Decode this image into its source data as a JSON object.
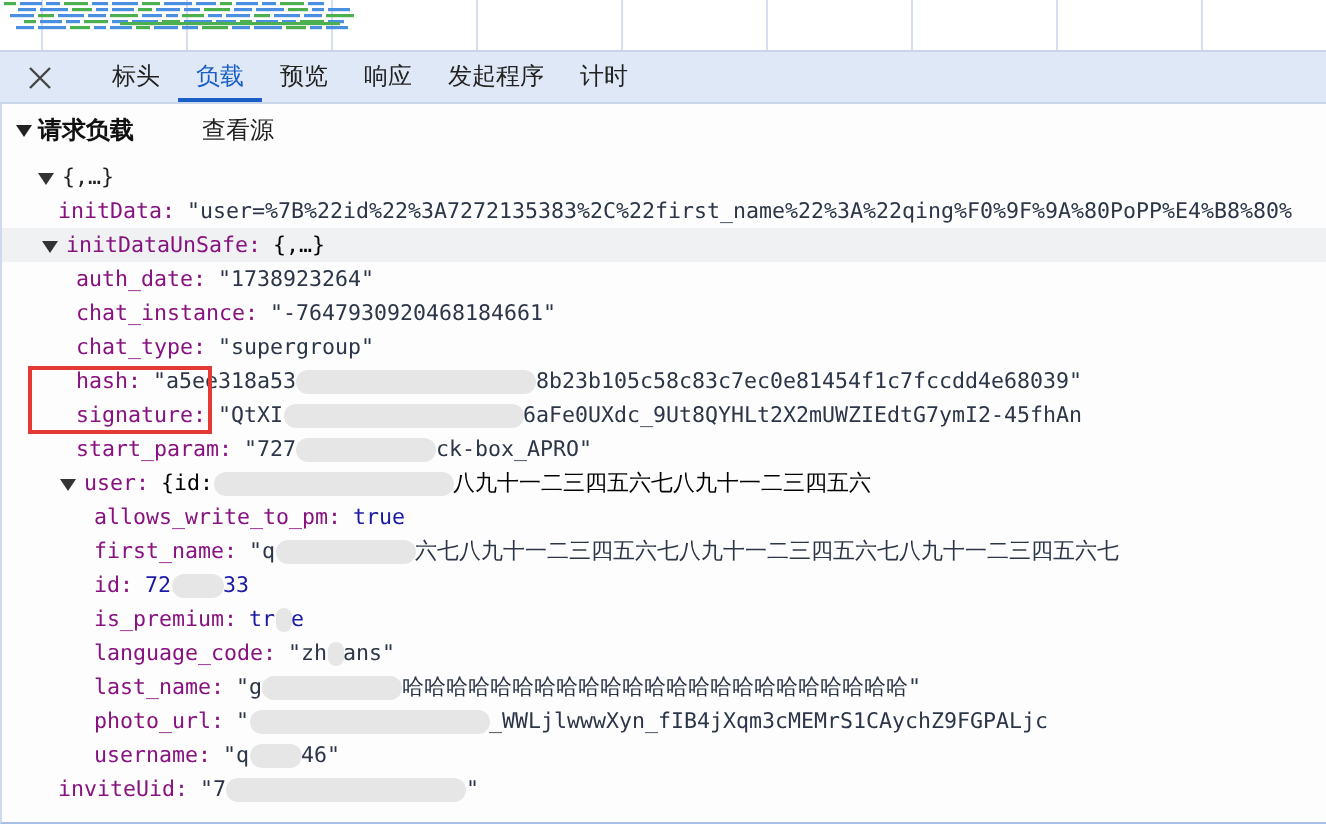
{
  "tabs": [
    {
      "label": "标头",
      "selected": false
    },
    {
      "label": "负载",
      "selected": true
    },
    {
      "label": "预览",
      "selected": false
    },
    {
      "label": "响应",
      "selected": false
    },
    {
      "label": "发起程序",
      "selected": false
    },
    {
      "label": "计时",
      "selected": false
    }
  ],
  "payload": {
    "title": "请求负载",
    "expanded": true,
    "view_source": "查看源",
    "tree": [
      {
        "label": "{,…}",
        "expanded": true,
        "selected": false,
        "marked": false,
        "children": [
          {
            "key": "initData:",
            "kind": "string",
            "selected": false,
            "marked": false,
            "value": [
              {
                "kind": "text",
                "text": "\"user=%7B%22id%22%3A7272135383%2C%22first_name%22%3A%22qing%F0%9F%9A%80PoPP%E4%B8%80%"
              }
            ]
          },
          {
            "key": "initDataUnSafe:",
            "kind": "preview",
            "expanded": true,
            "selected": true,
            "marked": false,
            "value": [
              {
                "kind": "text",
                "text": "{,…}"
              }
            ],
            "children": [
              {
                "key": "auth_date:",
                "kind": "string",
                "selected": false,
                "marked": false,
                "value": [
                  {
                    "kind": "text",
                    "text": "\"1738923264\""
                  }
                ]
              },
              {
                "key": "chat_instance:",
                "kind": "string",
                "selected": false,
                "marked": false,
                "value": [
                  {
                    "kind": "text",
                    "text": "\"-7647930920468184661\""
                  }
                ]
              },
              {
                "key": "chat_type:",
                "kind": "string",
                "selected": false,
                "marked": false,
                "value": [
                  {
                    "kind": "text",
                    "text": "\"supergroup\""
                  }
                ]
              },
              {
                "key": "hash:",
                "kind": "string",
                "selected": false,
                "marked": true,
                "value": [
                  {
                    "kind": "text",
                    "text": "\"a5ee318a53"
                  },
                  {
                    "kind": "blur-wide"
                  },
                  {
                    "kind": "text",
                    "text": "8b23b105c58c83c7ec0e81454f1c7fccdd4e68039\""
                  }
                ]
              },
              {
                "key": "signature:",
                "kind": "string",
                "selected": false,
                "marked": true,
                "value": [
                  {
                    "kind": "text",
                    "text": "\"QtXI"
                  },
                  {
                    "kind": "blur-wide"
                  },
                  {
                    "kind": "text",
                    "text": "6aFe0UXdc_9Ut8QYHLt2X2mUWZIEdtG7ymI2-45fhAn"
                  }
                ]
              },
              {
                "key": "start_param:",
                "kind": "string",
                "selected": false,
                "marked": false,
                "value": [
                  {
                    "kind": "text",
                    "text": "\"727"
                  },
                  {
                    "kind": "blur"
                  },
                  {
                    "kind": "text",
                    "text": "ck-box_APRO\""
                  }
                ]
              },
              {
                "key": "user:",
                "kind": "preview",
                "expanded": true,
                "selected": false,
                "marked": false,
                "value": [
                  {
                    "kind": "text",
                    "text": "{id:"
                  },
                  {
                    "kind": "blur-wide"
                  },
                  {
                    "kind": "text",
                    "text": "八九十一二三四五六七八九十一二三四五六"
                  }
                ],
                "children": [
                  {
                    "key": "allows_write_to_pm:",
                    "kind": "literal",
                    "selected": false,
                    "marked": false,
                    "value": [
                      {
                        "kind": "text",
                        "text": "true"
                      }
                    ]
                  },
                  {
                    "key": "first_name:",
                    "kind": "string",
                    "selected": false,
                    "marked": false,
                    "value": [
                      {
                        "kind": "text",
                        "text": "\"q"
                      },
                      {
                        "kind": "blur"
                      },
                      {
                        "kind": "text",
                        "text": "六七八九十一二三四五六七八九十一二三四五六七八九十一二三四五六七"
                      }
                    ]
                  },
                  {
                    "key": "id:",
                    "kind": "literal",
                    "selected": false,
                    "marked": false,
                    "value": [
                      {
                        "kind": "text",
                        "text": "72"
                      },
                      {
                        "kind": "blur-short"
                      },
                      {
                        "kind": "text",
                        "text": "33"
                      }
                    ]
                  },
                  {
                    "key": "is_premium:",
                    "kind": "literal",
                    "selected": false,
                    "marked": false,
                    "value": [
                      {
                        "kind": "text",
                        "text": "tr"
                      },
                      {
                        "kind": "blur-tiny"
                      },
                      {
                        "kind": "text",
                        "text": "e"
                      }
                    ]
                  },
                  {
                    "key": "language_code:",
                    "kind": "string",
                    "selected": false,
                    "marked": false,
                    "value": [
                      {
                        "kind": "text",
                        "text": "\"zh"
                      },
                      {
                        "kind": "blur-tiny"
                      },
                      {
                        "kind": "text",
                        "text": "ans\""
                      }
                    ]
                  },
                  {
                    "key": "last_name:",
                    "kind": "string",
                    "selected": false,
                    "marked": false,
                    "value": [
                      {
                        "kind": "text",
                        "text": "\"g"
                      },
                      {
                        "kind": "blur"
                      },
                      {
                        "kind": "text",
                        "text": "哈哈哈哈哈哈哈哈哈哈哈哈哈哈哈哈哈哈哈哈哈哈哈\""
                      }
                    ]
                  },
                  {
                    "key": "photo_url:",
                    "kind": "string",
                    "selected": false,
                    "marked": false,
                    "value": [
                      {
                        "kind": "text",
                        "text": "\""
                      },
                      {
                        "kind": "blur-wide"
                      },
                      {
                        "kind": "text",
                        "text": "_WWLjlwwwXyn_fIB4jXqm3cMEMrS1CAychZ9FGPALjc"
                      }
                    ]
                  },
                  {
                    "key": "username:",
                    "kind": "string",
                    "selected": false,
                    "marked": false,
                    "value": [
                      {
                        "kind": "text",
                        "text": "\"q"
                      },
                      {
                        "kind": "blur-short"
                      },
                      {
                        "kind": "text",
                        "text": "46\""
                      }
                    ]
                  }
                ]
              }
            ]
          },
          {
            "key": "inviteUid:",
            "kind": "string",
            "selected": false,
            "marked": false,
            "value": [
              {
                "kind": "text",
                "text": "\"7"
              },
              {
                "kind": "blur-wide"
              },
              {
                "kind": "text",
                "text": "\""
              }
            ]
          }
        ]
      }
    ]
  }
}
